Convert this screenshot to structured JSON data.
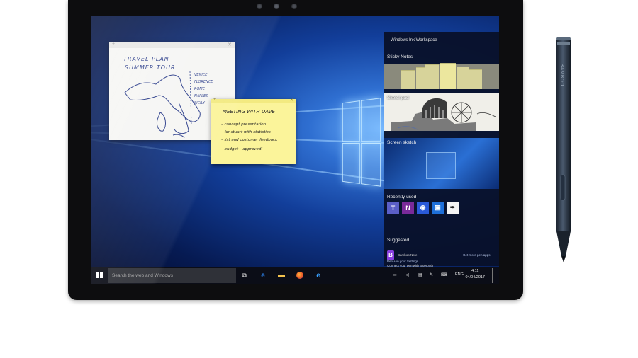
{
  "ink_workspace": {
    "title": "Windows Ink Workspace",
    "sticky_notes_label": "Sticky Notes",
    "sketchpad_label": "Sketchpad",
    "screen_sketch_label": "Screen sketch",
    "recently_used_label": "Recently used",
    "recent_apps": [
      {
        "icon": "teams-icon",
        "glyph": "T",
        "color": "#5b5fc7"
      },
      {
        "icon": "onenote-icon",
        "glyph": "N",
        "color": "#7a2a9a"
      },
      {
        "icon": "maps-icon",
        "glyph": "◉",
        "color": "#2a5ad8"
      },
      {
        "icon": "photos-icon",
        "glyph": "▣",
        "color": "#1e6fd9"
      },
      {
        "icon": "pen-app-icon",
        "glyph": "✒",
        "color": "#f4f4f4"
      }
    ],
    "suggested_label": "Suggested",
    "suggested_app": "Bamboo Note",
    "get_more_link": "Get more pen apps",
    "connect_text_1": "Connect your pen with Bluetooth",
    "connect_text_2": "Pen + in your Settings"
  },
  "notes": {
    "white_title_1": "TRAVEL PLAN",
    "white_title_2": "SUMMER TOUR",
    "yellow_title": "MEETING WITH DAVE",
    "yellow_lines": [
      "– concept presentation",
      "– for stuart with statistics",
      "– list and customer feedback",
      "– budget – approved!"
    ]
  },
  "map_labels": [
    "VENICE",
    "FLORENCE",
    "ROME",
    "NAPLES",
    "SICILY"
  ],
  "taskbar": {
    "search_placeholder": "Search the web and Windows",
    "language": "ENG",
    "time": "4:11",
    "date": "04/04/2017"
  },
  "pen": {
    "brand": "BAMBOO"
  }
}
